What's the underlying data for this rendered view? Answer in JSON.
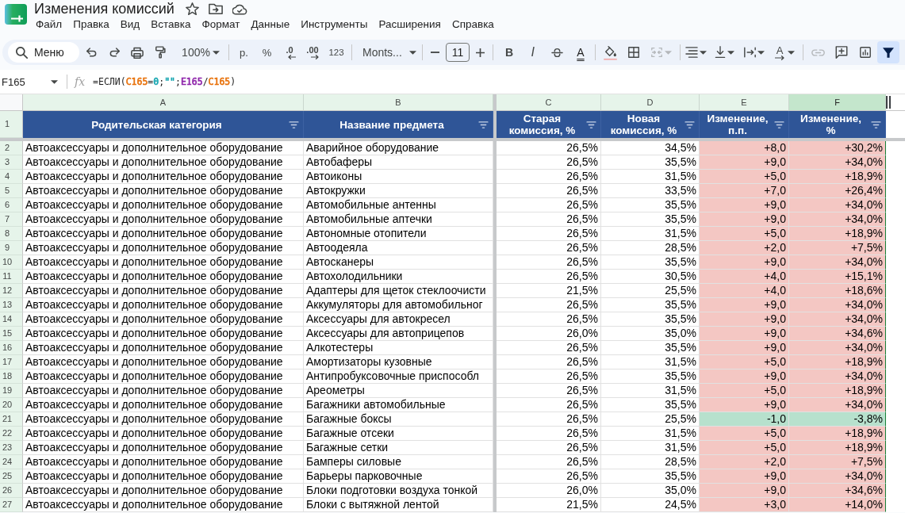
{
  "header": {
    "title": "Изменения комиссий",
    "menu": [
      "Файл",
      "Правка",
      "Вид",
      "Вставка",
      "Формат",
      "Данные",
      "Инструменты",
      "Расширения",
      "Справка"
    ]
  },
  "toolbar": {
    "search": {
      "placeholder": "Меню"
    },
    "zoom": "100%",
    "currency": "р.",
    "percent": "%",
    "decrease_decimal": ".0",
    "increase_decimal": ".00",
    "number_format": "123",
    "font": "Monts...",
    "font_size": "11",
    "bold": "B",
    "italic": "I",
    "text_color": "A",
    "merge": {
      "disabled": true
    },
    "rotation": "A",
    "link": {
      "disabled": true
    },
    "filter": {
      "on": true
    }
  },
  "formula_bar": {
    "cell": "F165",
    "fx": "fx",
    "formula": [
      {
        "text": "=ЕСЛИ("
      },
      {
        "text": "C165",
        "color": "#e8710a"
      },
      {
        "text": "="
      },
      {
        "text": "0",
        "color": "#12a4af"
      },
      {
        "text": ";"
      },
      {
        "text": "\"\"",
        "color": "#12a4af"
      },
      {
        "text": ";"
      },
      {
        "text": "E165",
        "color": "#8e24aa"
      },
      {
        "text": "/"
      },
      {
        "text": "C165",
        "color": "#e8710a"
      },
      {
        "text": ")"
      }
    ]
  },
  "sheet": {
    "columns": [
      {
        "letter": "A",
        "title": "Родительская категория",
        "selected": false
      },
      {
        "letter": "B",
        "title": "Название предмета",
        "selected": false
      },
      {
        "letter": "C",
        "title": "Старая\nкомиссия, %",
        "selected": false
      },
      {
        "letter": "D",
        "title": "Новая\nкомиссия, %",
        "selected": false
      },
      {
        "letter": "E",
        "title": "Изменение,\nп.п.",
        "selected": false
      },
      {
        "letter": "F",
        "title": "Изменение,\n%",
        "selected": true
      }
    ],
    "header_row": "1",
    "rows": [
      {
        "number": "2",
        "cells": [
          "Автоаксессуары и дополнительное оборудование",
          "Аварийное оборудование",
          "26,5%",
          "34,5%",
          "+8,0",
          "+30,2%"
        ],
        "color": "#f4c7c3"
      },
      {
        "number": "3",
        "cells": [
          "Автоаксессуары и дополнительное оборудование",
          "Автобаферы",
          "26,5%",
          "35,5%",
          "+9,0",
          "+34,0%"
        ],
        "color": "#f4c7c3"
      },
      {
        "number": "4",
        "cells": [
          "Автоаксессуары и дополнительное оборудование",
          "Автоиконы",
          "26,5%",
          "31,5%",
          "+5,0",
          "+18,9%"
        ],
        "color": "#f4c7c3"
      },
      {
        "number": "5",
        "cells": [
          "Автоаксессуары и дополнительное оборудование",
          "Автокружки",
          "26,5%",
          "33,5%",
          "+7,0",
          "+26,4%"
        ],
        "color": "#f4c7c3"
      },
      {
        "number": "6",
        "cells": [
          "Автоаксессуары и дополнительное оборудование",
          "Автомобильные антенны",
          "26,5%",
          "35,5%",
          "+9,0",
          "+34,0%"
        ],
        "color": "#f4c7c3"
      },
      {
        "number": "7",
        "cells": [
          "Автоаксессуары и дополнительное оборудование",
          "Автомобильные аптечки",
          "26,5%",
          "35,5%",
          "+9,0",
          "+34,0%"
        ],
        "color": "#f4c7c3"
      },
      {
        "number": "8",
        "cells": [
          "Автоаксессуары и дополнительное оборудование",
          "Автономные отопители",
          "26,5%",
          "31,5%",
          "+5,0",
          "+18,9%"
        ],
        "color": "#f4c7c3"
      },
      {
        "number": "9",
        "cells": [
          "Автоаксессуары и дополнительное оборудование",
          "Автоодеяла",
          "26,5%",
          "28,5%",
          "+2,0",
          "+7,5%"
        ],
        "color": "#f4c7c3"
      },
      {
        "number": "10",
        "cells": [
          "Автоаксессуары и дополнительное оборудование",
          "Автосканеры",
          "26,5%",
          "35,5%",
          "+9,0",
          "+34,0%"
        ],
        "color": "#f4c7c3"
      },
      {
        "number": "11",
        "cells": [
          "Автоаксессуары и дополнительное оборудование",
          "Автохолодильники",
          "26,5%",
          "30,5%",
          "+4,0",
          "+15,1%"
        ],
        "color": "#f4c7c3"
      },
      {
        "number": "12",
        "cells": [
          "Автоаксессуары и дополнительное оборудование",
          "Адаптеры для щеток стеклоочисти",
          "21,5%",
          "25,5%",
          "+4,0",
          "+18,6%"
        ],
        "color": "#f4c7c3"
      },
      {
        "number": "13",
        "cells": [
          "Автоаксессуары и дополнительное оборудование",
          "Аккумуляторы для автомобильног",
          "26,5%",
          "35,5%",
          "+9,0",
          "+34,0%"
        ],
        "color": "#f4c7c3"
      },
      {
        "number": "14",
        "cells": [
          "Автоаксессуары и дополнительное оборудование",
          "Аксессуары для автокресел",
          "26,5%",
          "35,5%",
          "+9,0",
          "+34,0%"
        ],
        "color": "#f4c7c3"
      },
      {
        "number": "15",
        "cells": [
          "Автоаксессуары и дополнительное оборудование",
          "Аксессуары для автоприцепов",
          "26,0%",
          "35,0%",
          "+9,0",
          "+34,6%"
        ],
        "color": "#f4c7c3"
      },
      {
        "number": "16",
        "cells": [
          "Автоаксессуары и дополнительное оборудование",
          "Алкотестеры",
          "26,5%",
          "35,5%",
          "+9,0",
          "+34,0%"
        ],
        "color": "#f4c7c3"
      },
      {
        "number": "17",
        "cells": [
          "Автоаксессуары и дополнительное оборудование",
          "Амортизаторы кузовные",
          "26,5%",
          "31,5%",
          "+5,0",
          "+18,9%"
        ],
        "color": "#f4c7c3"
      },
      {
        "number": "18",
        "cells": [
          "Автоаксессуары и дополнительное оборудование",
          "Антипробуксовочные приспособл",
          "26,5%",
          "35,5%",
          "+9,0",
          "+34,0%"
        ],
        "color": "#f4c7c3"
      },
      {
        "number": "19",
        "cells": [
          "Автоаксессуары и дополнительное оборудование",
          "Ареометры",
          "26,5%",
          "31,5%",
          "+5,0",
          "+18,9%"
        ],
        "color": "#f4c7c3"
      },
      {
        "number": "20",
        "cells": [
          "Автоаксессуары и дополнительное оборудование",
          "Багажники автомобильные",
          "26,5%",
          "35,5%",
          "+9,0",
          "+34,0%"
        ],
        "color": "#f4c7c3"
      },
      {
        "number": "21",
        "cells": [
          "Автоаксессуары и дополнительное оборудование",
          "Багажные боксы",
          "26,5%",
          "25,5%",
          "-1,0",
          "-3,8%"
        ],
        "color": "#b7e1cd"
      },
      {
        "number": "22",
        "cells": [
          "Автоаксессуары и дополнительное оборудование",
          "Багажные отсеки",
          "26,5%",
          "31,5%",
          "+5,0",
          "+18,9%"
        ],
        "color": "#f4c7c3"
      },
      {
        "number": "23",
        "cells": [
          "Автоаксессуары и дополнительное оборудование",
          "Багажные сетки",
          "26,5%",
          "31,5%",
          "+5,0",
          "+18,9%"
        ],
        "color": "#f4c7c3"
      },
      {
        "number": "24",
        "cells": [
          "Автоаксессуары и дополнительное оборудование",
          "Бамперы силовые",
          "26,5%",
          "28,5%",
          "+2,0",
          "+7,5%"
        ],
        "color": "#f4c7c3"
      },
      {
        "number": "25",
        "cells": [
          "Автоаксессуары и дополнительное оборудование",
          "Барьеры парковочные",
          "26,5%",
          "35,5%",
          "+9,0",
          "+34,0%"
        ],
        "color": "#f4c7c3"
      },
      {
        "number": "26",
        "cells": [
          "Автоаксессуары и дополнительное оборудование",
          "Блоки подготовки воздуха тонкой",
          "26,0%",
          "35,0%",
          "+9,0",
          "+34,6%"
        ],
        "color": "#f4c7c3"
      },
      {
        "number": "27",
        "cells": [
          "Автоаксессуары и дополнительное оборудование",
          "Блоки с вытяжной лентой",
          "21,5%",
          "24,5%",
          "+3,0",
          "+14,0%"
        ],
        "color": "#f4c7c3"
      }
    ]
  }
}
